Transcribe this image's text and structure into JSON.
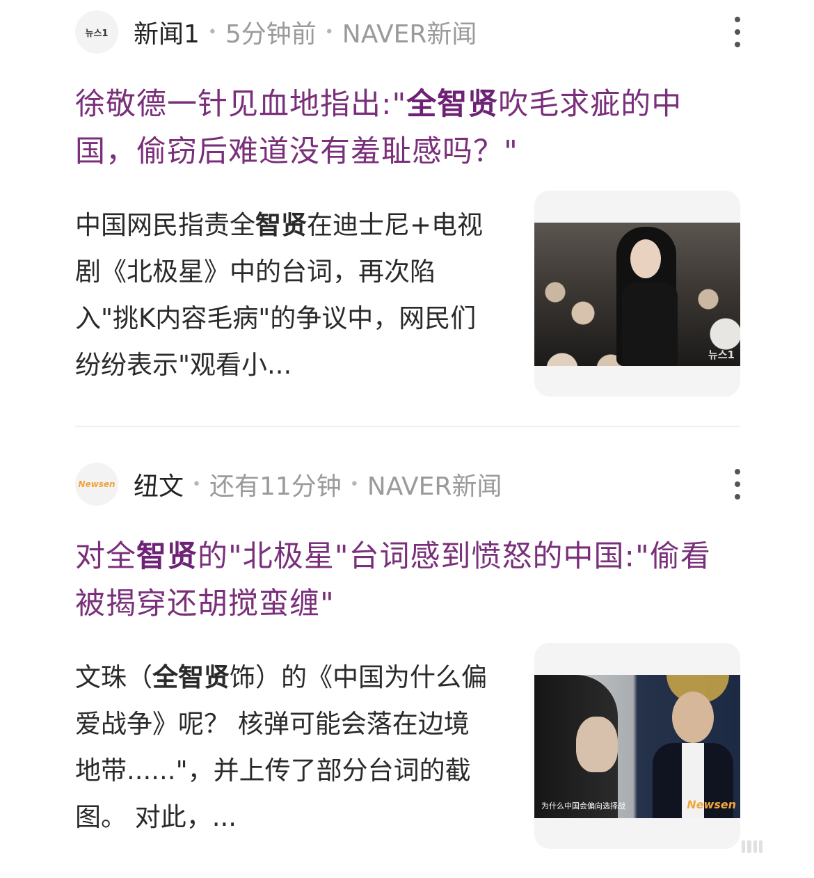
{
  "articles": [
    {
      "source": {
        "logo_text": "뉴스1",
        "name": "新闻1",
        "time": "5分钟前",
        "publisher": "NAVER新闻"
      },
      "headline": {
        "part1": "徐敬德一针见血地指出:\"",
        "highlight": "全智贤",
        "part2": "吹毛求疵的中国，偷窃后难道没有羞耻感吗？\""
      },
      "snippet": {
        "part1": "中国网民指责全",
        "highlight": "智贤",
        "part2": "在迪士尼+电视剧《北极星》中的台词，再次陷入\"挑K内容毛病\"的争议中，网民们纷纷表示\"观看小..."
      },
      "thumbnail": {
        "watermark": "뉴스1"
      }
    },
    {
      "source": {
        "logo_text": "Newsen",
        "name": "纽文",
        "time": "还有11分钟",
        "publisher": "NAVER新闻"
      },
      "headline": {
        "part1": "对全",
        "highlight": "智贤",
        "part2": "的\"北极星\"台词感到愤怒的中国:\"偷看被揭穿还胡搅蛮缠\""
      },
      "snippet": {
        "part1": "文珠（",
        "highlight": "全智贤",
        "part2": "饰）的《中国为什么偏爱战争》呢？ 核弹可能会落在边境地带......\"，并上传了部分台词的截图。 对此，..."
      },
      "thumbnail": {
        "caption": "为什么中国会偏向选择战",
        "watermark": "Newsen"
      }
    }
  ],
  "colors": {
    "headline": "#7a2f7a",
    "meta": "#9a9a9a",
    "body": "#2a2a2a"
  }
}
